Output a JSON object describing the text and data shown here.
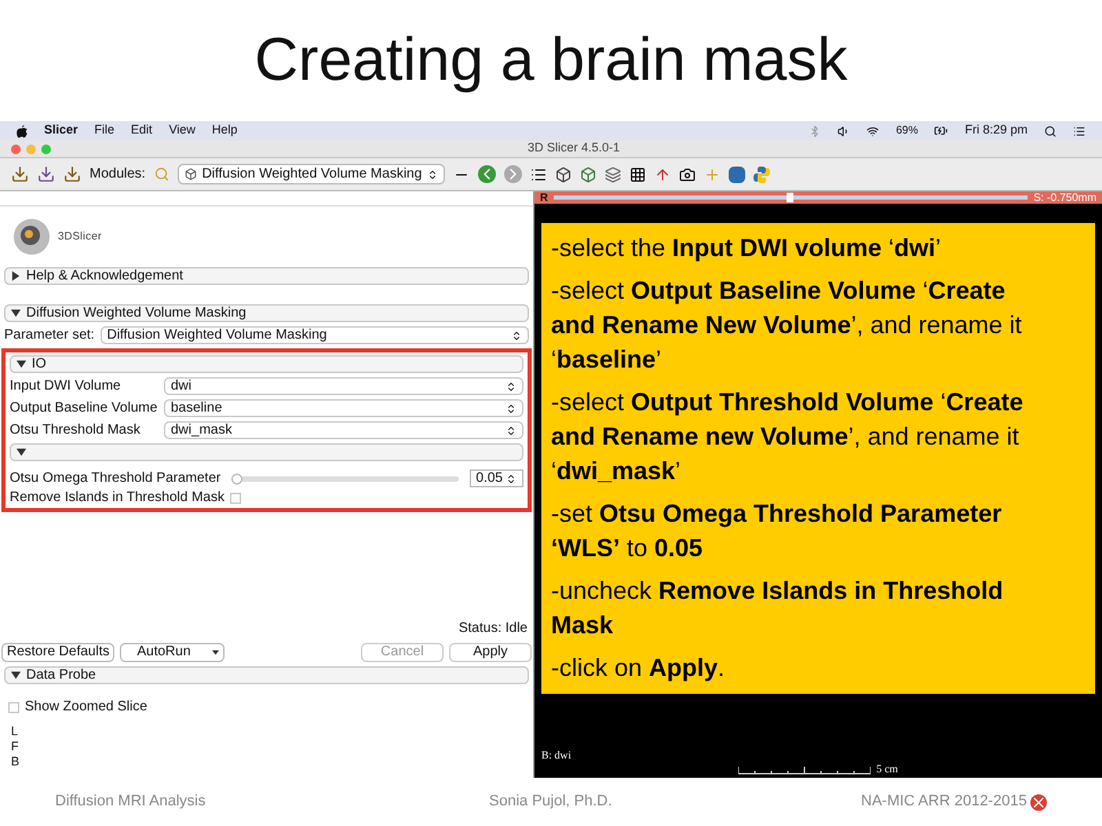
{
  "slide_title": "Creating a brain mask",
  "menu_bar": {
    "items": [
      "Slicer",
      "File",
      "Edit",
      "View",
      "Help"
    ],
    "battery": "69%",
    "clock": "Fri 8:29 pm"
  },
  "window": {
    "title": "3D Slicer 4.5.0-1"
  },
  "toolbar": {
    "modules_label": "Modules:",
    "module": "Diffusion Weighted Volume Masking"
  },
  "logo_text": "3DSlicer",
  "help_section": {
    "label": "Help & Acknowledgement",
    "expanded": false
  },
  "module_section": {
    "label": "Diffusion Weighted Volume Masking",
    "expanded": true
  },
  "parameter_set": {
    "label": "Parameter set:",
    "value": "Diffusion Weighted Volume Masking"
  },
  "io_section": {
    "label": "IO",
    "expanded": true,
    "rows": [
      {
        "label": "Input DWI Volume",
        "value": "dwi"
      },
      {
        "label": "Output Baseline Volume",
        "value": "baseline"
      },
      {
        "label": "Otsu Threshold Mask",
        "value": "dwi_mask"
      }
    ]
  },
  "advanced_section": {
    "expanded": true
  },
  "threshold": {
    "label": "Otsu Omega Threshold Parameter",
    "level": 0,
    "value": "0.05"
  },
  "remove_islands": {
    "label": "Remove Islands in Threshold Mask",
    "checked": false
  },
  "status": "Status: Idle",
  "left_buttons": [
    {
      "label": "Restore Defaults",
      "kind": "plain"
    },
    {
      "label": "AutoRun",
      "kind": "split"
    }
  ],
  "right_buttons": [
    {
      "label": "Cancel",
      "disabled": true
    },
    {
      "label": "Apply",
      "disabled": false
    }
  ],
  "data_probe": {
    "label": "Data Probe",
    "expanded": true,
    "show_zoomed": {
      "label": "Show Zoomed Slice",
      "checked": false
    },
    "lines": [
      "L",
      "F",
      "B"
    ]
  },
  "slice_view": {
    "letter": "R",
    "offset": "S: -0.750mm",
    "level": 0.49,
    "volume_label": "B: dwi",
    "scale_label": "5 cm"
  },
  "callout": [
    "-select the **Input DWI volume** ‘**dwi**’",
    "-select **Output Baseline Volume** ‘**Create and Rename New Volume**’, and rename it ‘**baseline**’",
    "-select **Output Threshold Volume** ‘**Create and Rename new Volume**’, and rename it ‘**dwi_mask**’",
    "-set **Otsu Omega Threshold Parameter ‘WLS’** to **0.05**",
    "-uncheck **Remove Islands in Threshold Mask**",
    "-click on **Apply**."
  ],
  "footer": [
    "Diffusion MRI Analysis",
    "Sonia Pujol, Ph.D.",
    "NA-MIC ARR 2012-2015"
  ]
}
